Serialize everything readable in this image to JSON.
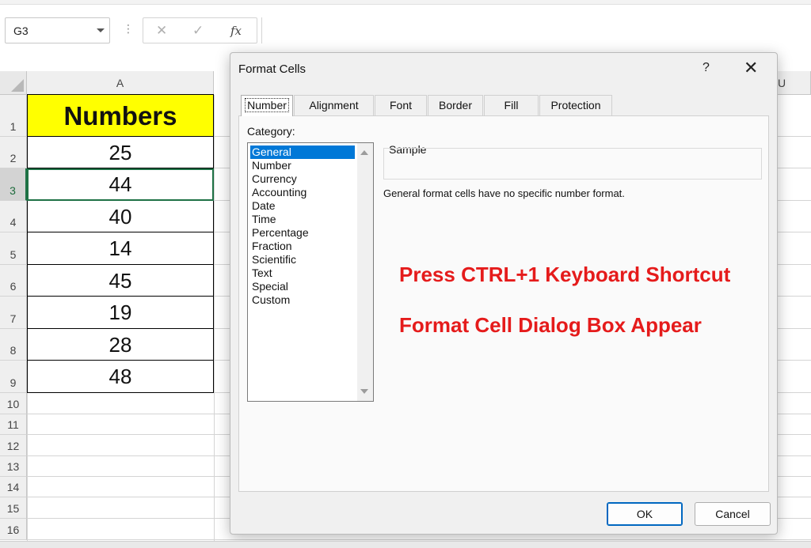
{
  "formula_bar": {
    "name_box": "G3",
    "dots": "⋮",
    "cancel_glyph": "✕",
    "enter_glyph": "✓",
    "fx_label": "fx",
    "formula_value": ""
  },
  "sheet": {
    "columns": [
      "A",
      "U"
    ],
    "rows": [
      "1",
      "2",
      "3",
      "4",
      "5",
      "6",
      "7",
      "8",
      "9",
      "10",
      "11",
      "12",
      "13",
      "14",
      "15",
      "16"
    ],
    "column_a": [
      "Numbers",
      "25",
      "44",
      "40",
      "14",
      "45",
      "19",
      "28",
      "48"
    ],
    "selected_row": "3",
    "header_fill": "#ffff00",
    "selection_color": "#1e7145"
  },
  "dialog": {
    "title": "Format Cells",
    "help_label": "?",
    "close_label": "✕",
    "tabs": [
      "Number",
      "Alignment",
      "Font",
      "Border",
      "Fill",
      "Protection"
    ],
    "active_tab": "Number",
    "category_label": "Category:",
    "categories": [
      "General",
      "Number",
      "Currency",
      "Accounting",
      "Date",
      "Time",
      "Percentage",
      "Fraction",
      "Scientific",
      "Text",
      "Special",
      "Custom"
    ],
    "selected_category": "General",
    "sample_label": "Sample",
    "sample_value": "",
    "description": "General format cells have no specific number format.",
    "ok_label": "OK",
    "cancel_label": "Cancel"
  },
  "annotations": {
    "line1": "Press CTRL+1 Keyboard Shortcut",
    "line2": "Format Cell Dialog Box Appear",
    "color": "#e51b1b"
  },
  "icons": {
    "name_box_dropdown": "chevron-down-icon",
    "cancel_formula": "close-icon",
    "enter_formula": "check-icon",
    "insert_function": "fx-icon",
    "select_all": "select-all-triangle-icon",
    "scroll_up": "scroll-up-arrow-icon",
    "scroll_down": "scroll-down-arrow-icon"
  }
}
